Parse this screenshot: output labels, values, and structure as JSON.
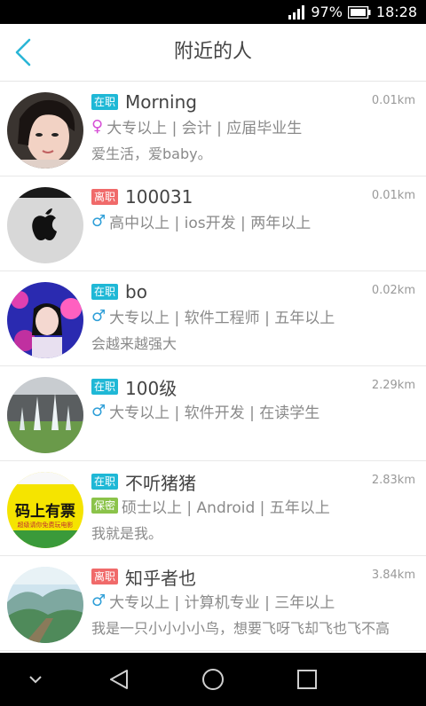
{
  "status_bar": {
    "battery": "97%",
    "time": "18:28"
  },
  "header": {
    "title": "附近的人"
  },
  "people": [
    {
      "status": "在职",
      "status_type": "on",
      "name": "Morning",
      "distance": "0.01km",
      "gender": "female",
      "info": "大专以上 | 会计 | 应届毕业生",
      "bio": "爱生活，爱baby。",
      "avatar": "portrait-girl"
    },
    {
      "status": "离职",
      "status_type": "off",
      "name": "100031",
      "distance": "0.01km",
      "gender": "male",
      "info": "高中以上 | ios开发 | 两年以上",
      "bio": "",
      "avatar": "apple-logo"
    },
    {
      "status": "在职",
      "status_type": "on",
      "name": "bo",
      "distance": "0.02km",
      "gender": "male",
      "info": "大专以上 | 软件工程师 | 五年以上",
      "bio": "会越来越强大",
      "avatar": "portrait-girl-pink"
    },
    {
      "status": "在职",
      "status_type": "on",
      "name": "100级",
      "distance": "2.29km",
      "gender": "male",
      "info": "大专以上 | 软件开发 | 在读学生",
      "bio": "",
      "avatar": "fountain"
    },
    {
      "status": "在职",
      "status_type": "on",
      "name": "不听猪猪",
      "distance": "2.83km",
      "gender": "secret",
      "secret_label": "保密",
      "info": "硕士以上 | Android | 五年以上",
      "bio": "我就是我。",
      "avatar": "coding-banner"
    },
    {
      "status": "离职",
      "status_type": "off",
      "name": "知乎者也",
      "distance": "3.84km",
      "gender": "male",
      "info": "大专以上 | 计算机专业 | 三年以上",
      "bio": "我是一只小小小小鸟，想要飞呀飞却飞也飞不高",
      "avatar": "landscape"
    }
  ],
  "avatar_banner_text": "码上有票",
  "avatar_banner_subtext": "超级请你免费玩电影"
}
